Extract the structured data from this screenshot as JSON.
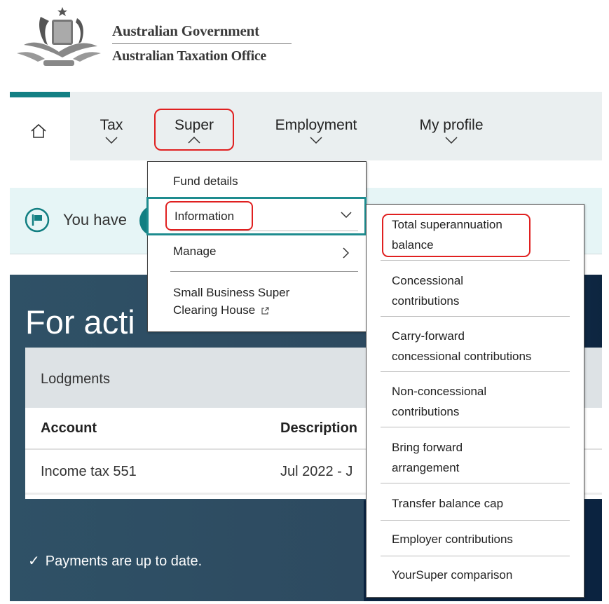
{
  "header": {
    "gov_name": "Australian Government",
    "agency_name": "Australian Taxation Office",
    "crest_icon": "coat-of-arms-icon"
  },
  "nav": {
    "home_icon": "home-icon",
    "items": [
      {
        "label": "Tax",
        "chevron": "chevron-down-icon"
      },
      {
        "label": "Super",
        "chevron": "chevron-up-icon",
        "expanded": true
      },
      {
        "label": "Employment",
        "chevron": "chevron-down-icon"
      },
      {
        "label": "My profile",
        "chevron": "chevron-down-icon"
      }
    ]
  },
  "super_menu": {
    "items": [
      {
        "label": "Fund details"
      },
      {
        "label": "Information",
        "chevron": "chevron-down-icon",
        "expanded": true
      },
      {
        "label": "Manage",
        "chevron": "chevron-right-icon"
      },
      {
        "label": "Small Business Super Clearing House",
        "line1": "Small Business Super",
        "line2": "Clearing House",
        "icon": "external-link-icon"
      }
    ]
  },
  "information_menu": {
    "items": [
      {
        "line1": "Total superannuation",
        "line2": "balance"
      },
      {
        "line1": "Concessional",
        "line2": "contributions"
      },
      {
        "line1": "Carry-forward",
        "line2": "concessional contributions"
      },
      {
        "line1": "Non-concessional",
        "line2": "contributions"
      },
      {
        "line1": "Bring forward",
        "line2": "arrangement"
      },
      {
        "line1": "Transfer balance cap"
      },
      {
        "line1": "Employer contributions"
      },
      {
        "line1": "YourSuper comparison"
      }
    ]
  },
  "banner": {
    "icon": "flag-icon",
    "text": "You have"
  },
  "action_panel": {
    "title": "For acti",
    "lodgments": {
      "heading": "Lodgments",
      "columns": [
        "Account",
        "Description"
      ],
      "rows": [
        {
          "account": "Income tax 551",
          "description": "Jul 2022 - J"
        }
      ]
    },
    "payments_status": "Payments are up to date.",
    "payments_icon": "checkmark-icon"
  },
  "colors": {
    "accent_teal": "#138084",
    "highlight_red": "#e02020",
    "panel_dark": "#2f5166",
    "nav_bg": "#eaeff0",
    "banner_bg": "#e6f5f6"
  }
}
